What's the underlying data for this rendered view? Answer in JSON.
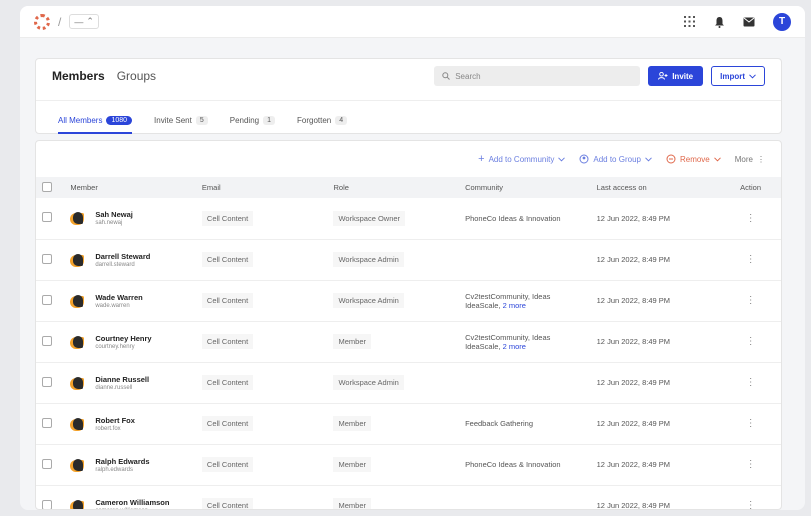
{
  "topbar": {
    "workspace_value": "—",
    "workspace_chevron": "⌃",
    "avatar_initial": "T",
    "icons": [
      "grid-icon",
      "bell-icon",
      "inbox-icon"
    ]
  },
  "header": {
    "tab_members": "Members",
    "tab_groups": "Groups",
    "search_placeholder": "Search",
    "invite_label": "Invite",
    "import_label": "Import"
  },
  "subtabs": [
    {
      "label": "All Members",
      "count": "1080"
    },
    {
      "label": "Invite Sent",
      "count": "5"
    },
    {
      "label": "Pending",
      "count": "1"
    },
    {
      "label": "Forgotten",
      "count": "4"
    }
  ],
  "bulk": {
    "add_community": "Add to Community",
    "add_group": "Add to Group",
    "remove": "Remove",
    "more": "More"
  },
  "columns": [
    "Member",
    "Email",
    "Role",
    "Community",
    "Last access on",
    "Action"
  ],
  "rows": [
    {
      "name": "Sah Newaj",
      "handle": "sah.newaj",
      "email": "Cell Content",
      "role": "Workspace Owner",
      "community": "PhoneCo Ideas & Innovation",
      "community_more": "",
      "last": "12 Jun 2022, 8:49 PM"
    },
    {
      "name": "Darrell Steward",
      "handle": "darrell.steward",
      "email": "Cell Content",
      "role": "Workspace Admin",
      "community": "",
      "community_more": "",
      "last": "12 Jun 2022, 8:49 PM"
    },
    {
      "name": "Wade Warren",
      "handle": "wade.warren",
      "email": "Cell Content",
      "role": "Workspace Admin",
      "community": "Cv2testCommunity, Ideas IdeaScale,",
      "community_more": "2 more",
      "last": "12 Jun 2022, 8:49 PM"
    },
    {
      "name": "Courtney Henry",
      "handle": "courtney.henry",
      "email": "Cell Content",
      "role": "Member",
      "community": "Cv2testCommunity, Ideas IdeaScale,",
      "community_more": "2 more",
      "last": "12 Jun 2022, 8:49 PM"
    },
    {
      "name": "Dianne Russell",
      "handle": "dianne.russell",
      "email": "Cell Content",
      "role": "Workspace Admin",
      "community": "",
      "community_more": "",
      "last": "12 Jun 2022, 8:49 PM"
    },
    {
      "name": "Robert Fox",
      "handle": "robert.fox",
      "email": "Cell Content",
      "role": "Member",
      "community": "Feedback Gathering",
      "community_more": "",
      "last": "12 Jun 2022, 8:49 PM"
    },
    {
      "name": "Ralph Edwards",
      "handle": "ralph.edwards",
      "email": "Cell Content",
      "role": "Member",
      "community": "PhoneCo Ideas & Innovation",
      "community_more": "",
      "last": "12 Jun 2022, 8:49 PM"
    },
    {
      "name": "Cameron Williamson",
      "handle": "cameron.williamson",
      "email": "Cell Content",
      "role": "Member",
      "community": "",
      "community_more": "",
      "last": "12 Jun 2022, 8:49 PM"
    }
  ],
  "colors": {
    "accent": "#2b45d9",
    "danger": "#e0684b"
  }
}
